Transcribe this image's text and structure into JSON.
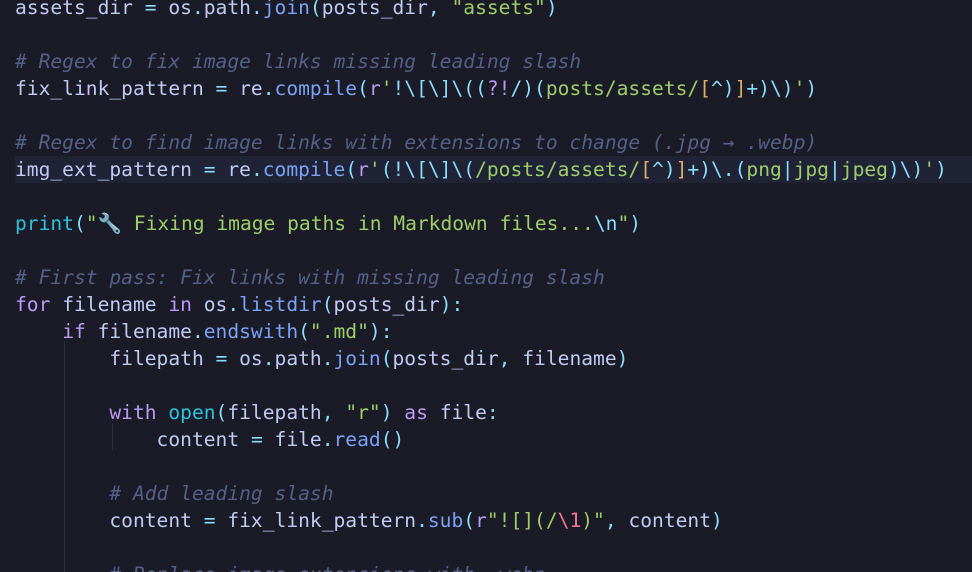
{
  "editor": {
    "language": "python",
    "theme_colors": {
      "background": "#1a1b26",
      "current_line": "#1f2335",
      "keyword": "#bb9af7",
      "function": "#7aa2f7",
      "string": "#9ece6a",
      "escape": "#89ddff",
      "bracket": "#e0af68",
      "comment": "#565f89",
      "variable": "#c0caf5"
    },
    "lines": [
      {
        "tokens": [
          [
            "var",
            "assets_dir "
          ],
          [
            "pun",
            "= "
          ],
          [
            "var",
            "os"
          ],
          [
            "pun",
            "."
          ],
          [
            "var",
            "path"
          ],
          [
            "pun",
            "."
          ],
          [
            "fn",
            "join"
          ],
          [
            "pun",
            "("
          ],
          [
            "var",
            "posts_dir"
          ],
          [
            "pun",
            ", "
          ],
          [
            "str",
            "\"assets\""
          ],
          [
            "pun",
            ")"
          ]
        ]
      },
      {
        "tokens": []
      },
      {
        "tokens": [
          [
            "cm",
            "# Regex to fix image links missing leading slash"
          ]
        ]
      },
      {
        "tokens": [
          [
            "var",
            "fix_link_pattern "
          ],
          [
            "pun",
            "= "
          ],
          [
            "var",
            "re"
          ],
          [
            "pun",
            "."
          ],
          [
            "fn",
            "compile"
          ],
          [
            "pun",
            "("
          ],
          [
            "kw",
            "r"
          ],
          [
            "str",
            "'"
          ],
          [
            "esc",
            "!\\[\\]\\(("
          ],
          [
            "kw",
            "?!"
          ],
          [
            "esc",
            "/"
          ],
          [
            "esc",
            ")("
          ],
          [
            "str",
            "posts/assets/"
          ],
          [
            "br",
            "["
          ],
          [
            "esc",
            "^)"
          ],
          [
            "br",
            "]"
          ],
          [
            "esc",
            "+)\\)"
          ],
          [
            "str",
            "'"
          ],
          [
            "pun",
            ")"
          ]
        ]
      },
      {
        "tokens": []
      },
      {
        "tokens": [
          [
            "cm",
            "# Regex to find image links with extensions to change (.jpg → .webp)"
          ]
        ]
      },
      {
        "tokens": [
          [
            "var",
            "img_ext_pattern "
          ],
          [
            "pun",
            "= "
          ],
          [
            "var",
            "re"
          ],
          [
            "pun",
            "."
          ],
          [
            "fn",
            "compile"
          ],
          [
            "pun",
            "("
          ],
          [
            "kw",
            "r"
          ],
          [
            "str",
            "'"
          ],
          [
            "esc",
            "(!\\[\\]\\("
          ],
          [
            "str",
            "/posts/assets/"
          ],
          [
            "br",
            "["
          ],
          [
            "esc",
            "^)"
          ],
          [
            "br",
            "]"
          ],
          [
            "esc",
            "+)\\.("
          ],
          [
            "str",
            "png"
          ],
          [
            "esc",
            "|"
          ],
          [
            "str",
            "jpg"
          ],
          [
            "esc",
            "|"
          ],
          [
            "str",
            "jpeg"
          ],
          [
            "esc",
            ")\\)"
          ],
          [
            "str",
            "'"
          ],
          [
            "pun",
            ")"
          ]
        ],
        "current": true
      },
      {
        "tokens": []
      },
      {
        "tokens": [
          [
            "bi",
            "print"
          ],
          [
            "pun",
            "("
          ],
          [
            "str",
            "\"🔧 Fixing image paths in Markdown files..."
          ],
          [
            "esc",
            "\\n"
          ],
          [
            "str",
            "\""
          ],
          [
            "pun",
            ")"
          ]
        ]
      },
      {
        "tokens": []
      },
      {
        "tokens": [
          [
            "cm",
            "# First pass: Fix links with missing leading slash"
          ]
        ]
      },
      {
        "tokens": [
          [
            "kw",
            "for "
          ],
          [
            "var",
            "filename "
          ],
          [
            "kw",
            "in "
          ],
          [
            "var",
            "os"
          ],
          [
            "pun",
            "."
          ],
          [
            "fn",
            "listdir"
          ],
          [
            "pun",
            "("
          ],
          [
            "var",
            "posts_dir"
          ],
          [
            "pun",
            "):"
          ]
        ]
      },
      {
        "tokens": [
          [
            "var",
            "    "
          ],
          [
            "kw",
            "if "
          ],
          [
            "var",
            "filename"
          ],
          [
            "pun",
            "."
          ],
          [
            "fn",
            "endswith"
          ],
          [
            "pun",
            "("
          ],
          [
            "str",
            "\".md\""
          ],
          [
            "pun",
            "):"
          ]
        ]
      },
      {
        "tokens": [
          [
            "var",
            "        filepath "
          ],
          [
            "pun",
            "= "
          ],
          [
            "var",
            "os"
          ],
          [
            "pun",
            "."
          ],
          [
            "var",
            "path"
          ],
          [
            "pun",
            "."
          ],
          [
            "fn",
            "join"
          ],
          [
            "pun",
            "("
          ],
          [
            "var",
            "posts_dir"
          ],
          [
            "pun",
            ", "
          ],
          [
            "var",
            "filename"
          ],
          [
            "pun",
            ")"
          ]
        ]
      },
      {
        "tokens": []
      },
      {
        "tokens": [
          [
            "var",
            "        "
          ],
          [
            "kw",
            "with "
          ],
          [
            "bi",
            "open"
          ],
          [
            "pun",
            "("
          ],
          [
            "var",
            "filepath"
          ],
          [
            "pun",
            ", "
          ],
          [
            "str",
            "\"r\""
          ],
          [
            "pun",
            ") "
          ],
          [
            "kw",
            "as "
          ],
          [
            "var",
            "file"
          ],
          [
            "pun",
            ":"
          ]
        ]
      },
      {
        "tokens": [
          [
            "var",
            "            content "
          ],
          [
            "pun",
            "= "
          ],
          [
            "var",
            "file"
          ],
          [
            "pun",
            "."
          ],
          [
            "fn",
            "read"
          ],
          [
            "pun",
            "()"
          ]
        ]
      },
      {
        "tokens": []
      },
      {
        "tokens": [
          [
            "var",
            "        "
          ],
          [
            "cm",
            "# Add leading slash"
          ]
        ]
      },
      {
        "tokens": [
          [
            "var",
            "        content "
          ],
          [
            "pun",
            "= "
          ],
          [
            "var",
            "fix_link_pattern"
          ],
          [
            "pun",
            "."
          ],
          [
            "fn",
            "sub"
          ],
          [
            "pun",
            "("
          ],
          [
            "kw",
            "r"
          ],
          [
            "str",
            "\"![](/"
          ],
          [
            "bad",
            "\\1"
          ],
          [
            "str",
            ")\""
          ],
          [
            "pun",
            ", "
          ],
          [
            "var",
            "content"
          ],
          [
            "pun",
            ")"
          ]
        ]
      },
      {
        "tokens": []
      },
      {
        "tokens": [
          [
            "var",
            "        "
          ],
          [
            "cm",
            "# Replace image extensions with .webp"
          ]
        ]
      }
    ]
  }
}
